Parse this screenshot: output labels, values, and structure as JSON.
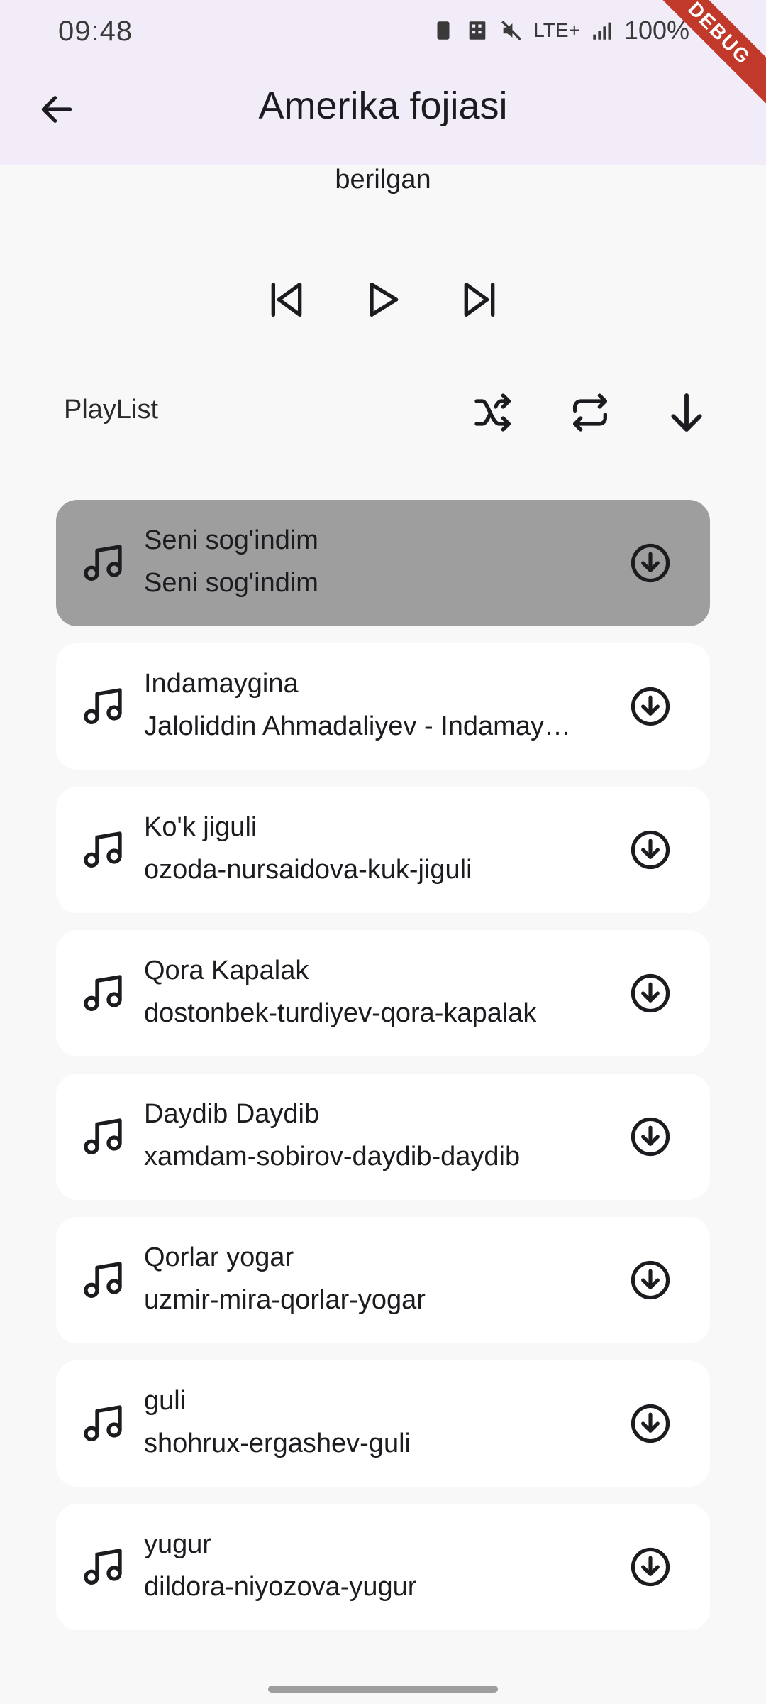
{
  "status_bar": {
    "time": "09:48",
    "battery": "100%",
    "network": "LTE+",
    "debug_label": "DEBUG"
  },
  "app_bar": {
    "title": "Amerika fojiasi",
    "back_icon": "arrow-left-icon"
  },
  "now_playing": {
    "subtitle": "berilgan"
  },
  "controls": {
    "previous_icon": "skip-previous-icon",
    "play_icon": "play-icon",
    "next_icon": "skip-next-icon"
  },
  "playlist": {
    "label": "PlayList",
    "shuffle_icon": "shuffle-icon",
    "repeat_icon": "repeat-icon",
    "download_all_icon": "arrow-down-icon",
    "songs": [
      {
        "title": "Seni sog'indim",
        "subtitle": "Seni sog'indim",
        "active": true
      },
      {
        "title": "Indamaygina",
        "subtitle": "Jaloliddin Ahmadaliyev - Indamaygina",
        "active": false
      },
      {
        "title": "Ko'k jiguli",
        "subtitle": "ozoda-nursaidova-kuk-jiguli",
        "active": false
      },
      {
        "title": "Qora Kapalak",
        "subtitle": "dostonbek-turdiyev-qora-kapalak",
        "active": false
      },
      {
        "title": "Daydib Daydib",
        "subtitle": "xamdam-sobirov-daydib-daydib",
        "active": false
      },
      {
        "title": "Qorlar yogar",
        "subtitle": "uzmir-mira-qorlar-yogar",
        "active": false
      },
      {
        "title": "guli",
        "subtitle": "shohrux-ergashev-guli",
        "active": false
      },
      {
        "title": "yugur",
        "subtitle": "dildora-niyozova-yugur",
        "active": false
      }
    ]
  },
  "colors": {
    "app_bar_bg": "#f2ecf9",
    "page_bg": "#f8f8f9",
    "active_item_bg": "#9e9e9e",
    "item_bg": "#ffffff",
    "icon_color": "#1c1b1f"
  }
}
